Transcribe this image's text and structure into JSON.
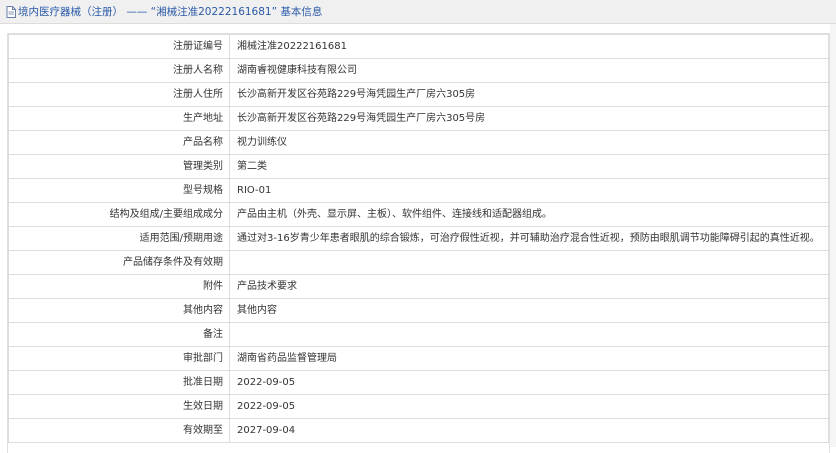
{
  "header": {
    "title": "境内医疗器械（注册） —— “湘械注准20222161681” 基本信息"
  },
  "rows": [
    {
      "label": "注册证编号",
      "value": "湘械注准20222161681"
    },
    {
      "label": "注册人名称",
      "value": "湖南睿视健康科技有限公司"
    },
    {
      "label": "注册人住所",
      "value": "长沙高新开发区谷苑路229号海凭园生产厂房六305房"
    },
    {
      "label": "生产地址",
      "value": "长沙高新开发区谷苑路229号海凭园生产厂房六305号房"
    },
    {
      "label": "产品名称",
      "value": "视力训练仪"
    },
    {
      "label": "管理类别",
      "value": "第二类"
    },
    {
      "label": "型号规格",
      "value": "RIO-01"
    },
    {
      "label": "结构及组成/主要组成成分",
      "value": "产品由主机（外壳、显示屏、主板）、软件组件、连接线和适配器组成。"
    },
    {
      "label": "适用范围/预期用途",
      "value": "通过对3-16岁青少年患者眼肌的综合锻炼，可治疗假性近视，并可辅助治疗混合性近视，预防由眼肌调节功能障碍引起的真性近视。"
    },
    {
      "label": "产品储存条件及有效期",
      "value": ""
    },
    {
      "label": "附件",
      "value": "产品技术要求"
    },
    {
      "label": "其他内容",
      "value": "其他内容"
    },
    {
      "label": "备注",
      "value": ""
    },
    {
      "label": "审批部门",
      "value": "湖南省药品监督管理局"
    },
    {
      "label": "批准日期",
      "value": "2022-09-05"
    },
    {
      "label": "生效日期",
      "value": "2022-09-05"
    },
    {
      "label": "有效期至",
      "value": "2027-09-04"
    }
  ]
}
